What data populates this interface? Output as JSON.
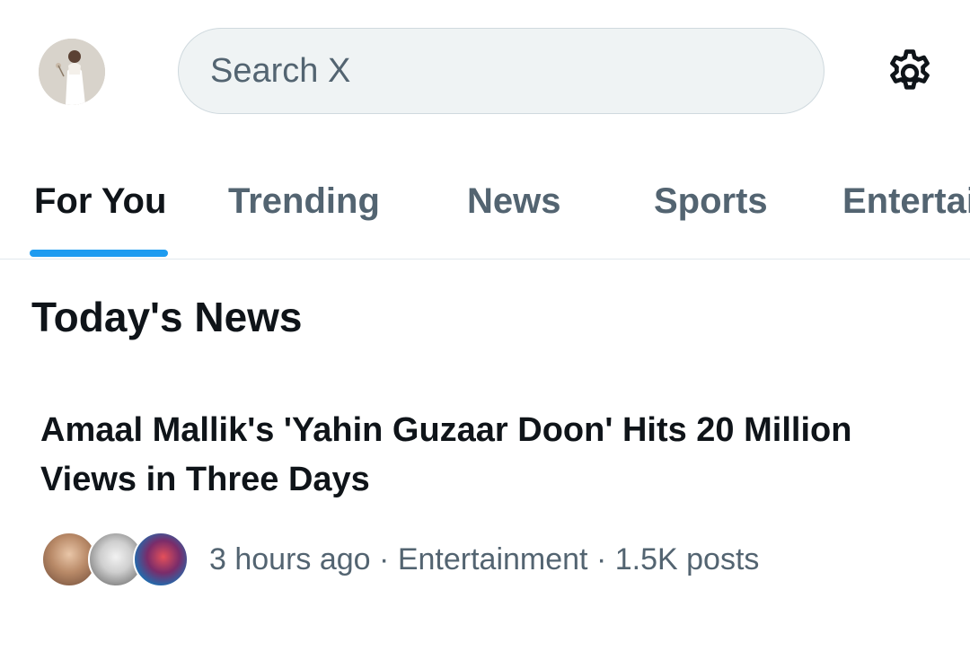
{
  "header": {
    "avatar_alt": "Profile",
    "search_placeholder": "Search X",
    "settings_icon": "gear-icon"
  },
  "tabs": [
    {
      "label": "For You",
      "active": true
    },
    {
      "label": "Trending",
      "active": false
    },
    {
      "label": "News",
      "active": false
    },
    {
      "label": "Sports",
      "active": false
    },
    {
      "label": "Entertainment",
      "active": false
    }
  ],
  "section": {
    "title": "Today's News"
  },
  "news": [
    {
      "headline": "Amaal Mallik's 'Yahin Guzaar Doon' Hits 20 Million Views in Three Days",
      "time": "3 hours ago",
      "category": "Entertainment",
      "posts": "1.5K posts",
      "separator": "·"
    }
  ],
  "colors": {
    "accent": "#1d9bf0",
    "text_primary": "#0f1419",
    "text_secondary": "#536471",
    "search_bg": "#eff3f4"
  }
}
